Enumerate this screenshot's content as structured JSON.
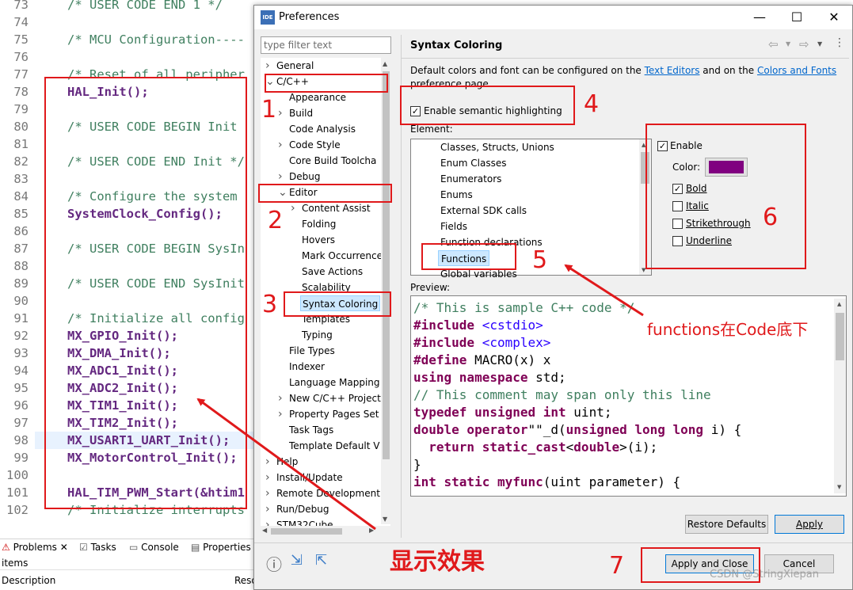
{
  "editor": {
    "lines": [
      {
        "n": "73",
        "t": "/* USER CODE END 1 */",
        "k": "cm"
      },
      {
        "n": "74",
        "t": "",
        "k": "pl"
      },
      {
        "n": "75",
        "t": "/* MCU Configuration----",
        "k": "cm"
      },
      {
        "n": "76",
        "t": "",
        "k": "pl"
      },
      {
        "n": "77",
        "t": "/* Reset of all peripher",
        "k": "cm"
      },
      {
        "n": "78",
        "t": "HAL_Init();",
        "k": "fn"
      },
      {
        "n": "79",
        "t": "",
        "k": "pl"
      },
      {
        "n": "80",
        "t": "/* USER CODE BEGIN Init",
        "k": "cm"
      },
      {
        "n": "81",
        "t": "",
        "k": "pl"
      },
      {
        "n": "82",
        "t": "/* USER CODE END Init */",
        "k": "cm"
      },
      {
        "n": "83",
        "t": "",
        "k": "pl"
      },
      {
        "n": "84",
        "t": "/* Configure the system",
        "k": "cm"
      },
      {
        "n": "85",
        "t": "SystemClock_Config();",
        "k": "fn"
      },
      {
        "n": "86",
        "t": "",
        "k": "pl"
      },
      {
        "n": "87",
        "t": "/* USER CODE BEGIN SysIn",
        "k": "cm"
      },
      {
        "n": "88",
        "t": "",
        "k": "pl"
      },
      {
        "n": "89",
        "t": "/* USER CODE END SysInit",
        "k": "cm"
      },
      {
        "n": "90",
        "t": "",
        "k": "pl"
      },
      {
        "n": "91",
        "t": "/* Initialize all config",
        "k": "cm"
      },
      {
        "n": "92",
        "t": "MX_GPIO_Init();",
        "k": "fn"
      },
      {
        "n": "93",
        "t": "MX_DMA_Init();",
        "k": "fn"
      },
      {
        "n": "94",
        "t": "MX_ADC1_Init();",
        "k": "fn"
      },
      {
        "n": "95",
        "t": "MX_ADC2_Init();",
        "k": "fn"
      },
      {
        "n": "96",
        "t": "MX_TIM1_Init();",
        "k": "fn"
      },
      {
        "n": "97",
        "t": "MX_TIM2_Init();",
        "k": "fn"
      },
      {
        "n": "98",
        "t": "MX_USART1_UART_Init();",
        "k": "fn"
      },
      {
        "n": "99",
        "t": "MX_MotorControl_Init();",
        "k": "fn"
      },
      {
        "n": "100",
        "t": "",
        "k": "pl"
      },
      {
        "n": "101",
        "t": "HAL_TIM_PWM_Start(&htim1",
        "k": "fn"
      },
      {
        "n": "102",
        "t": "/* Initialize interrupts",
        "k": "cm"
      }
    ]
  },
  "bottom_panel": {
    "tabs": [
      "Problems",
      "Tasks",
      "Console",
      "Properties"
    ],
    "items_label": "items",
    "col_description": "Description",
    "col_resource": "Reso"
  },
  "dialog": {
    "title": "Preferences",
    "filter_placeholder": "type filter text",
    "tree": [
      {
        "label": "General",
        "indent": 0,
        "arrow": ">"
      },
      {
        "label": "C/C++",
        "indent": 0,
        "arrow": "v"
      },
      {
        "label": "Appearance",
        "indent": 1,
        "arrow": ""
      },
      {
        "label": "Build",
        "indent": 1,
        "arrow": ">"
      },
      {
        "label": "Code Analysis",
        "indent": 1,
        "arrow": ""
      },
      {
        "label": "Code Style",
        "indent": 1,
        "arrow": ">"
      },
      {
        "label": "Core Build Toolcha",
        "indent": 1,
        "arrow": ""
      },
      {
        "label": "Debug",
        "indent": 1,
        "arrow": ">"
      },
      {
        "label": "Editor",
        "indent": 1,
        "arrow": "v"
      },
      {
        "label": "Content Assist",
        "indent": 2,
        "arrow": ">"
      },
      {
        "label": "Folding",
        "indent": 2,
        "arrow": ""
      },
      {
        "label": "Hovers",
        "indent": 2,
        "arrow": ""
      },
      {
        "label": "Mark Occurrence",
        "indent": 2,
        "arrow": ""
      },
      {
        "label": "Save Actions",
        "indent": 2,
        "arrow": ""
      },
      {
        "label": "Scalability",
        "indent": 2,
        "arrow": ""
      },
      {
        "label": "Syntax Coloring",
        "indent": 2,
        "arrow": "",
        "selected": true
      },
      {
        "label": "Templates",
        "indent": 2,
        "arrow": ""
      },
      {
        "label": "Typing",
        "indent": 2,
        "arrow": ""
      },
      {
        "label": "File Types",
        "indent": 1,
        "arrow": ""
      },
      {
        "label": "Indexer",
        "indent": 1,
        "arrow": ""
      },
      {
        "label": "Language Mapping",
        "indent": 1,
        "arrow": ""
      },
      {
        "label": "New C/C++ Project",
        "indent": 1,
        "arrow": ">"
      },
      {
        "label": "Property Pages Set",
        "indent": 1,
        "arrow": ">"
      },
      {
        "label": "Task Tags",
        "indent": 1,
        "arrow": ""
      },
      {
        "label": "Template Default V",
        "indent": 1,
        "arrow": ""
      },
      {
        "label": "Help",
        "indent": 0,
        "arrow": ">"
      },
      {
        "label": "Install/Update",
        "indent": 0,
        "arrow": ">"
      },
      {
        "label": "Remote Development",
        "indent": 0,
        "arrow": ">"
      },
      {
        "label": "Run/Debug",
        "indent": 0,
        "arrow": ">"
      },
      {
        "label": "STM32Cube",
        "indent": 0,
        "arrow": ">"
      }
    ],
    "page_title": "Syntax Coloring",
    "desc_pre": "Default colors and font can be configured on the ",
    "desc_link1": "Text Editors",
    "desc_mid": " and on the ",
    "desc_link2": "Colors and Fonts",
    "desc_post": "preference page.",
    "semantic_label": "Enable semantic highlighting",
    "element_label": "Element:",
    "elements": [
      "Classes, Structs, Unions",
      "Enum Classes",
      "Enumerators",
      "Enums",
      "External SDK calls",
      "Fields",
      "Function declarations",
      "Functions",
      "Global variables"
    ],
    "selected_element": "Functions",
    "enable_label": "Enable",
    "color_label": "Color:",
    "bold_label": "Bold",
    "italic_label": "Italic",
    "strike_label": "Strikethrough",
    "underline_label": "Underline",
    "swatch_color": "#800080",
    "preview_label": "Preview:",
    "preview_lines": [
      [
        [
          "pcm",
          "/* This is sample C++ code */"
        ]
      ],
      [
        [
          "kw",
          "#include "
        ],
        [
          "inc",
          "<cstdio>"
        ]
      ],
      [
        [
          "kw",
          "#include "
        ],
        [
          "inc",
          "<complex>"
        ]
      ],
      [
        [
          "kw",
          "#define "
        ],
        [
          "",
          "MACRO(x) x"
        ]
      ],
      [
        [
          "kw",
          "using namespace "
        ],
        [
          "",
          "std;"
        ]
      ],
      [
        [
          "pcm",
          "// This comment may span only this line"
        ]
      ],
      [
        [
          "kw",
          "typedef unsigned int "
        ],
        [
          "",
          "uint;"
        ]
      ],
      [
        [
          "kw",
          "double operator"
        ],
        [
          "",
          "\"\"_d("
        ],
        [
          "kw",
          "unsigned long long "
        ],
        [
          "",
          "i) {"
        ]
      ],
      [
        [
          "",
          "  "
        ],
        [
          "kw",
          "return static_cast"
        ],
        [
          "",
          "<"
        ],
        [
          "kw",
          "double"
        ],
        [
          "",
          ">(i);"
        ]
      ],
      [
        [
          "",
          "}"
        ]
      ],
      [
        [
          "kw",
          "int static "
        ],
        [
          "kw",
          "myfunc"
        ],
        [
          "",
          "(uint parameter) {"
        ]
      ]
    ],
    "restore_label": "Restore Defaults",
    "apply_label": "Apply",
    "apply_close_label": "Apply and Close",
    "cancel_label": "Cancel"
  },
  "annotations": {
    "n1": "1",
    "n2": "2",
    "n3": "3",
    "n4": "4",
    "n5": "5",
    "n6": "6",
    "n7": "7",
    "note_functions": "functions在Code底下",
    "note_effect": "显示效果",
    "watermark": "CSDN @StringXiepan"
  }
}
